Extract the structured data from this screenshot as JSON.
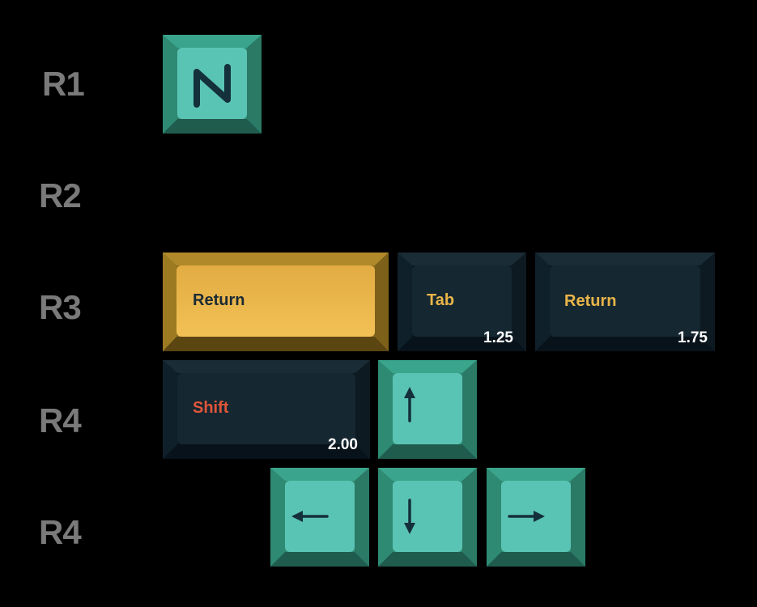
{
  "rows": [
    {
      "label": "R1"
    },
    {
      "label": "R2"
    },
    {
      "label": "R3"
    },
    {
      "label": "R4"
    },
    {
      "label": "R4"
    }
  ],
  "keys": {
    "logo": {
      "icon": "n-logo-icon"
    },
    "return_yellow": {
      "legend": "Return",
      "legend_color": "#1b2a33"
    },
    "tab_dark": {
      "legend": "Tab",
      "size": "1.25",
      "legend_color": "#e9b54a"
    },
    "return_dark": {
      "legend": "Return",
      "size": "1.75",
      "legend_color": "#e9b54a"
    },
    "shift_dark": {
      "legend": "Shift",
      "size": "2.00",
      "legend_color": "#e0553a"
    },
    "arrow_up": {
      "icon": "arrow-up-icon"
    },
    "arrow_left": {
      "icon": "arrow-left-icon"
    },
    "arrow_down": {
      "icon": "arrow-down-icon"
    },
    "arrow_right": {
      "icon": "arrow-right-icon"
    }
  },
  "colors": {
    "teal_cap": "#5ac4b4",
    "teal_side": "#2f8a73",
    "yellow_cap": "#f2c155",
    "dark_cap": "#152730",
    "legend_dark": "#1b2a33",
    "row_label": "#7a7a7a"
  }
}
